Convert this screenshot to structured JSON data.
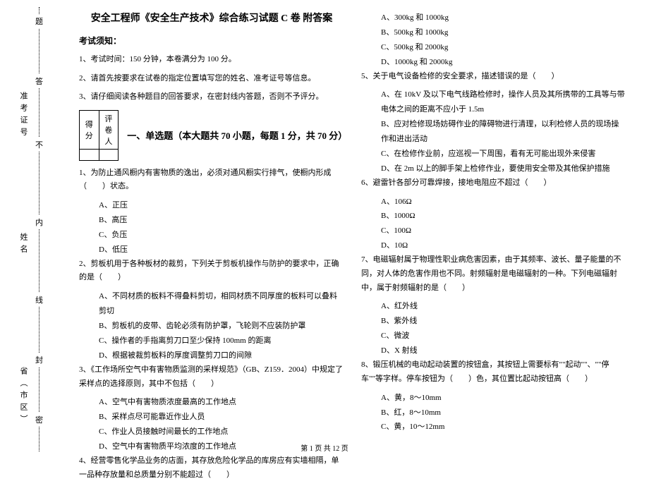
{
  "binding": {
    "province": "省（市区）",
    "name": "姓名",
    "exam_id": "准考证号",
    "seal_chars": [
      "密",
      "封",
      "线",
      "内",
      "不",
      "答",
      "题"
    ]
  },
  "header": {
    "title": "安全工程师《安全生产技术》综合练习试题 C 卷  附答案",
    "notice_label": "考试须知：",
    "notice1": "1、考试时间：150 分钟，本卷满分为 100 分。",
    "notice2": "2、请首先按要求在试卷的指定位置填写您的姓名、准考证号等信息。",
    "notice3": "3、请仔细阅读各种题目的回答要求，在密封线内答题，否则不予评分。"
  },
  "score_table": {
    "c1": "得分",
    "c2": "评卷人"
  },
  "part1_title": "一、单选题（本大题共 70 小题，每题 1 分，共 70 分）",
  "q1": {
    "stem": "1、为防止通风橱内有害物质的逸出，必须对通风橱实行排气，使橱内形成（　　）状态。",
    "a": "A、正压",
    "b": "B、高压",
    "c": "C、负压",
    "d": "D、低压"
  },
  "q2": {
    "stem": "2、剪板机用于各种板材的裁剪，下列关于剪板机操作与防护的要求中，正确的是（　　）",
    "a": "A、不同材质的板料不得叠料剪切，相同材质不同厚度的板料可以叠料剪切",
    "b": "B、剪板机的皮带、齿轮必须有防护罩，飞轮则不应装防护罩",
    "c": "C、操作者的手指离剪刀口至少保持 100mm 的距离",
    "d": "D、根据被裁剪板料的厚度调整剪刀口的间隙"
  },
  "q3": {
    "stem": "3、《工作场所空气中有害物质监测的采样规范》（GB、Z159．2004）中规定了采样点的选择原则，其中不包括（　　）",
    "a": "A、空气中有害物质浓度最高的工作地点",
    "b": "B、采样点尽可能靠近作业人员",
    "c": "C、作业人员接触时间最长的工作地点",
    "d": "D、空气中有害物质平均浓度的工作地点"
  },
  "q4": {
    "stem": "4、经营零售化学品业务的店面，其存放危险化学品的库房应有实墙相隔，单一品种存放量和总质量分别不能超过（　　）"
  },
  "q4opts": {
    "a": "A、300kg 和 1000kg",
    "b": "B、500kg 和 1000kg",
    "c": "C、500kg 和 2000kg",
    "d": "D、1000kg 和 2000kg"
  },
  "q5": {
    "stem": "5、关于电气设备检修的安全要求，描述错误的是（　　）",
    "a": "A、在 10kV 及以下电气线路检修时，操作人员及其所携带的工具等与带电体之间的距离不应小于 1.5m",
    "b": "B、应对检修现场妨碍作业的障碍物进行清理，以利检修人员的现场操作和进出活动",
    "c": "C、在检修作业前，应巡视一下周围，看有无可能出现外来侵害",
    "d": "D、在 2m 以上的脚手架上检修作业，要使用安全带及其他保护措施"
  },
  "q6": {
    "stem": "6、避雷针各部分可靠焊接，接地电阻应不超过（　　）",
    "a": "A、106Ω",
    "b": "B、1000Ω",
    "c": "C、100Ω",
    "d": "D、10Ω"
  },
  "q7": {
    "stem": "7、电磁辐射属于物理性职业病危害因素，由于其频率、波长、量子能量的不同，对人体的危害作用也不同。射频辐射是电磁辐射的一种。下列电磁辐射中，属于射频辐射的是（　　）",
    "a": "A、红外线",
    "b": "B、紫外线",
    "c": "C、微波",
    "d": "D、X 射线"
  },
  "q8": {
    "stem": "8、锻压机械的电动起动装置的按钮盒，其按钮上需要标有\"\"起动\"\"、\"\"停车\"\"等字样。停车按钮为（　　）色，其位置比起动按钮高（　　）",
    "a": "A、黄，8～10mm",
    "b": "B、红，8～10mm",
    "c": "C、黄，10～12mm"
  },
  "footer": "第 1 页 共 12 页"
}
